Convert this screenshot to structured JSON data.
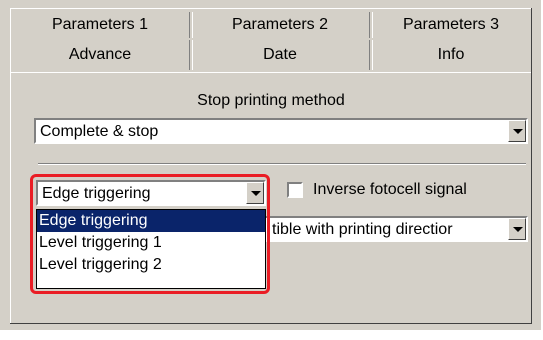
{
  "tabs_row1": [
    "Parameters 1",
    "Parameters 2",
    "Parameters 3"
  ],
  "tabs_row2": [
    "Advance",
    "Date",
    "Info"
  ],
  "active_tab": "Advance",
  "stop_method": {
    "label": "Stop printing method",
    "value": "Complete & stop"
  },
  "trigger": {
    "value": "Edge triggering",
    "options": [
      "Edge triggering",
      "Level triggering 1",
      "Level triggering 2"
    ],
    "selected_index": 0
  },
  "inverse_signal": {
    "label": "Inverse fotocell signal",
    "checked": false
  },
  "direction": {
    "value_visible": "tible with printing directior"
  },
  "colors": {
    "panel": "#d4d0c8",
    "selection": "#0a246a",
    "highlight": "#ea1d25"
  }
}
